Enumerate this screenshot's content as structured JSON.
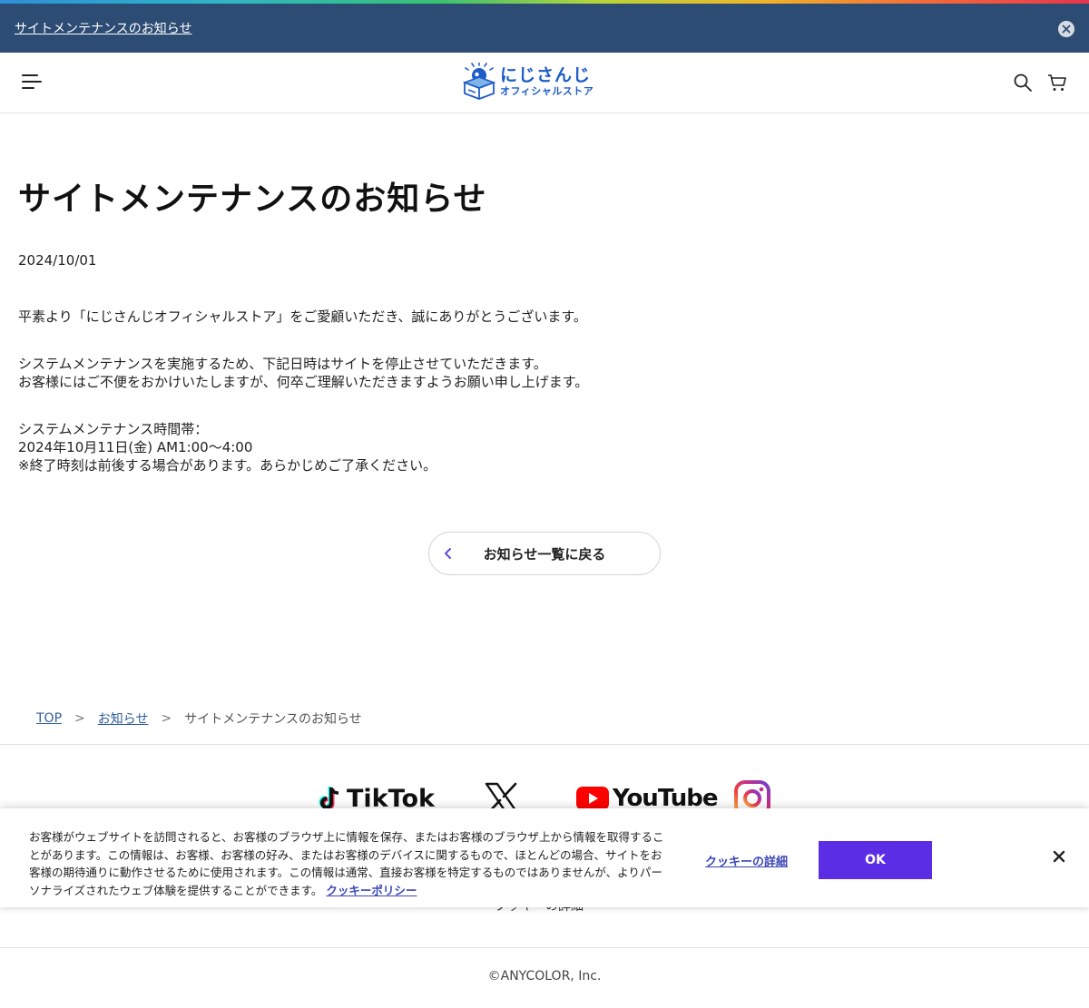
{
  "announcement": {
    "link_text": "サイトメンテナンスのお知らせ"
  },
  "header": {
    "logo_main": "にじさんじ",
    "logo_sub": "オフィシャルストア"
  },
  "article": {
    "title": "サイトメンテナンスのお知らせ",
    "date": "2024/10/01",
    "paragraphs": [
      [
        "平素より「にじさんじオフィシャルストア」をご愛顧いただき、誠にありがとうございます。"
      ],
      [
        "システムメンテナンスを実施するため、下記日時はサイトを停止させていただきます。",
        "お客様にはご不便をおかけいたしますが、何卒ご理解いただきますようお願い申し上げます。"
      ],
      [
        "システムメンテナンス時間帯：",
        "2024年10月11日(金) AM1:00～4:00",
        "※終了時刻は前後する場合があります。あらかじめご了承ください。"
      ]
    ],
    "back_button_label": "お知らせ一覧に戻る"
  },
  "breadcrumb": {
    "items": [
      "TOP",
      "お知らせ",
      "サイトメンテナンスのお知らせ"
    ],
    "separator": ">"
  },
  "footer": {
    "socials": {
      "tiktok": "TikTok",
      "youtube": "YouTube"
    },
    "cookie_details_link": "クッキーの詳細",
    "copyright": "©ANYCOLOR, Inc."
  },
  "cookie_banner": {
    "text": "お客様がウェブサイトを訪問されると、お客様のブラウザ上に情報を保存、またはお客様のブラウザ上から情報を取得することがあります。この情報は、お客様、お客様の好み、またはお客様のデバイスに関するもので、ほとんどの場合、サイトをお客様の期待通りに動作させるために使用されます。この情報は通常、直接お客様を特定するものではありませんが、よりパーソナライズされたウェブ体験を提供することができます。",
    "policy_link": "クッキーポリシー",
    "details_link": "クッキーの詳細",
    "ok_label": "OK"
  },
  "colors": {
    "announce_bg": "#2c4c74",
    "brand_blue": "#1f5cc8",
    "ok_button": "#5b2ee6",
    "link": "#3b47b8"
  }
}
